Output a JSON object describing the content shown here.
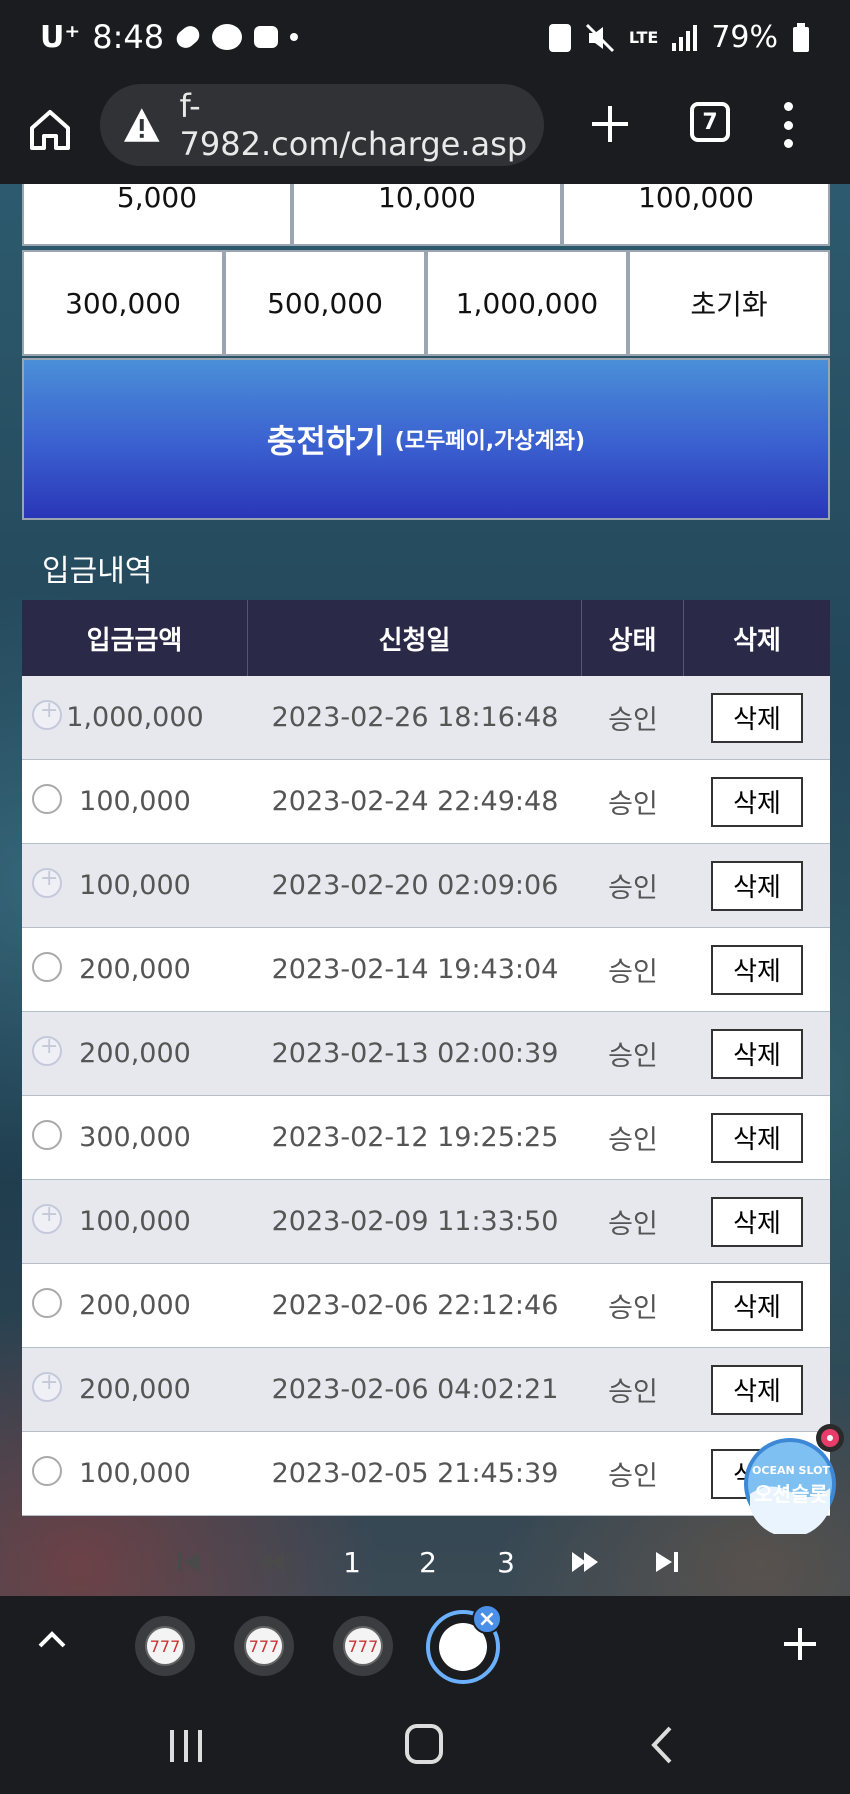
{
  "status_bar": {
    "carrier": "U⁺",
    "time": "8:48",
    "battery": "79%",
    "network": "LTE"
  },
  "browser": {
    "url": "f-7982.com/charge.asp",
    "tab_count": "7"
  },
  "amount_buttons_row1": [
    "5,000",
    "10,000",
    "100,000"
  ],
  "amount_buttons_row2": [
    "300,000",
    "500,000",
    "1,000,000"
  ],
  "reset_label": "초기화",
  "charge": {
    "main_label": "충전하기",
    "sub_label": "(모두페이,가상계좌)"
  },
  "section_title": "입금내역",
  "table": {
    "headers": [
      "입금금액",
      "신청일",
      "상태",
      "삭제"
    ],
    "rows": [
      {
        "amount": "1,000,000",
        "date": "2023-02-26 18:16:48",
        "status": "승인",
        "delete": "삭제"
      },
      {
        "amount": "100,000",
        "date": "2023-02-24 22:49:48",
        "status": "승인",
        "delete": "삭제"
      },
      {
        "amount": "100,000",
        "date": "2023-02-20 02:09:06",
        "status": "승인",
        "delete": "삭제"
      },
      {
        "amount": "200,000",
        "date": "2023-02-14 19:43:04",
        "status": "승인",
        "delete": "삭제"
      },
      {
        "amount": "200,000",
        "date": "2023-02-13 02:00:39",
        "status": "승인",
        "delete": "삭제"
      },
      {
        "amount": "300,000",
        "date": "2023-02-12 19:25:25",
        "status": "승인",
        "delete": "삭제"
      },
      {
        "amount": "100,000",
        "date": "2023-02-09 11:33:50",
        "status": "승인",
        "delete": "삭제"
      },
      {
        "amount": "200,000",
        "date": "2023-02-06 22:12:46",
        "status": "승인",
        "delete": "삭제"
      },
      {
        "amount": "200,000",
        "date": "2023-02-06 04:02:21",
        "status": "승인",
        "delete": "삭제"
      },
      {
        "amount": "100,000",
        "date": "2023-02-05 21:45:39",
        "status": "승인",
        "delete": "삭제"
      }
    ]
  },
  "pagination": {
    "pages": [
      "1",
      "2",
      "3"
    ]
  },
  "ocean_badge": {
    "en": "OCEAN SLOT",
    "ko": "오션슬롯"
  },
  "colors": {
    "charge_button_top": "#4a8fd8",
    "charge_button_bottom": "#2a36b8",
    "table_header_bg": "#2a2a48",
    "row_alt_bg": "#e7e8ee",
    "active_tab_ring": "#6ab0ff"
  }
}
